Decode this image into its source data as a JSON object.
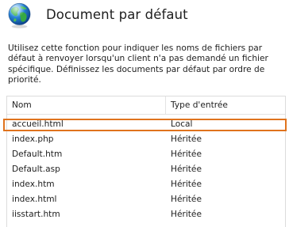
{
  "header": {
    "title": "Document par défaut",
    "icon": "globe-icon"
  },
  "description": "Utilisez cette fonction pour indiquer les noms de fichiers par défaut à renvoyer lorsqu'un client n'a pas demandé un fichier spécifique. Définissez les documents par défaut par ordre de priorité.",
  "table": {
    "columns": {
      "name": "Nom",
      "type": "Type d'entrée"
    },
    "rows": [
      {
        "name": "accueil.html",
        "type": "Local",
        "selected": true
      },
      {
        "name": "index.php",
        "type": "Héritée"
      },
      {
        "name": "Default.htm",
        "type": "Héritée"
      },
      {
        "name": "Default.asp",
        "type": "Héritée"
      },
      {
        "name": "index.htm",
        "type": "Héritée"
      },
      {
        "name": "index.html",
        "type": "Héritée"
      },
      {
        "name": "iisstart.htm",
        "type": "Héritée"
      }
    ]
  },
  "colors": {
    "selection_outline": "#e0731d",
    "text": "#1e1e1e",
    "border": "#dcdcdc"
  }
}
